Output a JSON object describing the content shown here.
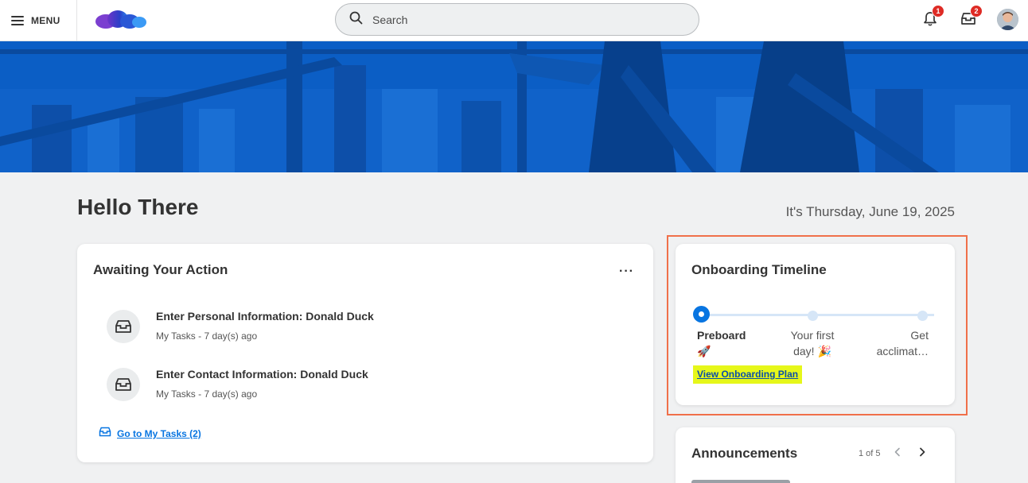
{
  "header": {
    "menu_label": "MENU",
    "search_placeholder": "Search",
    "notifications_count": "1",
    "inbox_count": "2"
  },
  "greeting": "Hello There",
  "date_text": "It's Thursday, June 19, 2025",
  "awaiting": {
    "title": "Awaiting Your Action",
    "more": "···",
    "tasks": [
      {
        "title": "Enter Personal Information: Donald Duck",
        "subtitle": "My Tasks - 7 day(s) ago"
      },
      {
        "title": "Enter Contact Information: Donald Duck",
        "subtitle": "My Tasks - 7 day(s) ago"
      }
    ],
    "goto_label": "Go to My Tasks (2)"
  },
  "onboarding": {
    "title": "Onboarding Timeline",
    "steps": [
      {
        "line1": "Preboard",
        "line2": "🚀"
      },
      {
        "line1": "Your first",
        "line2": "day! 🎉"
      },
      {
        "line1": "Get",
        "line2": "acclimat…"
      }
    ],
    "view_plan_label": "View Onboarding Plan"
  },
  "announcements": {
    "title": "Announcements",
    "pager": "1 of 5"
  },
  "colors": {
    "accent": "#0875e1",
    "banner": "#0a5fc4",
    "badge": "#de2b25",
    "highlight": "#e6f71a",
    "focus_border": "#f0704a"
  }
}
